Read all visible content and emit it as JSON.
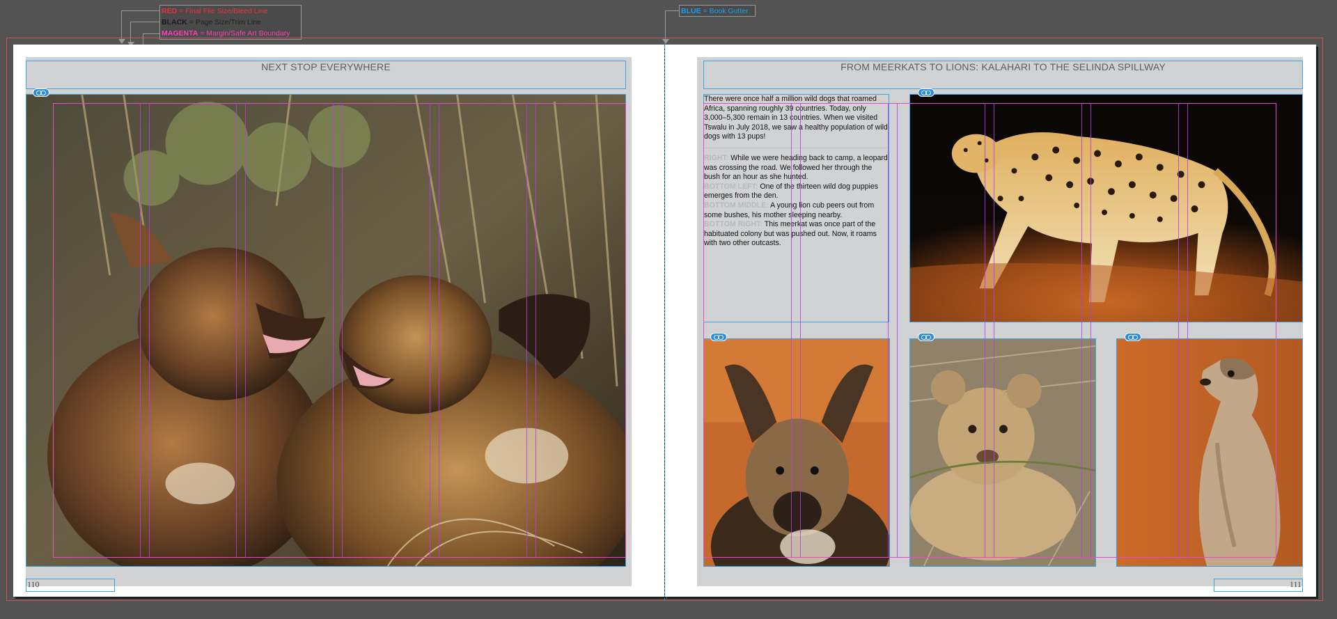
{
  "legend": {
    "red": {
      "key": "RED",
      "rest": " = Final File Size/Bleed Line",
      "color": "#e8323c"
    },
    "black": {
      "key": "BLACK",
      "rest": " = Page Size/Trim Line",
      "color": "#1a1a1a"
    },
    "magenta": {
      "key": "MAGENTA",
      "rest": " = Margin/Safe Art Boundary",
      "color": "#ff3fb6"
    },
    "blue": {
      "key": "BLUE",
      "rest": " = Book Gutter",
      "color": "#1aa0f0"
    }
  },
  "left_page": {
    "header": "NEXT STOP EVERYWHERE",
    "page_number": "110",
    "photo_icon": "wild-dog-puppies-photo"
  },
  "right_page": {
    "header": "FROM MEERKATS TO LIONS: KALAHARI TO THE SELINDA SPILLWAY",
    "page_number": "111",
    "intro": "There were once half a million wild dogs that roamed Africa, spanning roughly 39 countries. Today, only 3,000–5,300 remain in 13 countries. When we visited Tswalu in July 2018, we saw a healthy population of wild dogs with 13 pups!",
    "captions": [
      {
        "key": "RIGHT:",
        "text": " While we were heading back to camp, a leopard was crossing the road. We followed her through the bush for an hour as she hunted."
      },
      {
        "key": "BOTTOM LEFT:",
        "text": " One of the thirteen wild dog puppies emerges from the den."
      },
      {
        "key": "BOTTOM MIDDLE:",
        "text": " A young lion cub peers out from some bushes, his mother sleeping nearby."
      },
      {
        "key": "BOTTOM RIGHT:",
        "text": " This meerkat was once part of the habituated colony but was pushed out. Now, it roams with two other outcasts."
      }
    ]
  },
  "colors": {
    "bleed": "#d8505a",
    "frame": "#3aa3e6",
    "margin": "#e04fc8",
    "column_guide": "#b23fe0",
    "gutter": "#2d8fcf",
    "pasteboard": "#535353",
    "live_area": "#d1d2d4"
  }
}
